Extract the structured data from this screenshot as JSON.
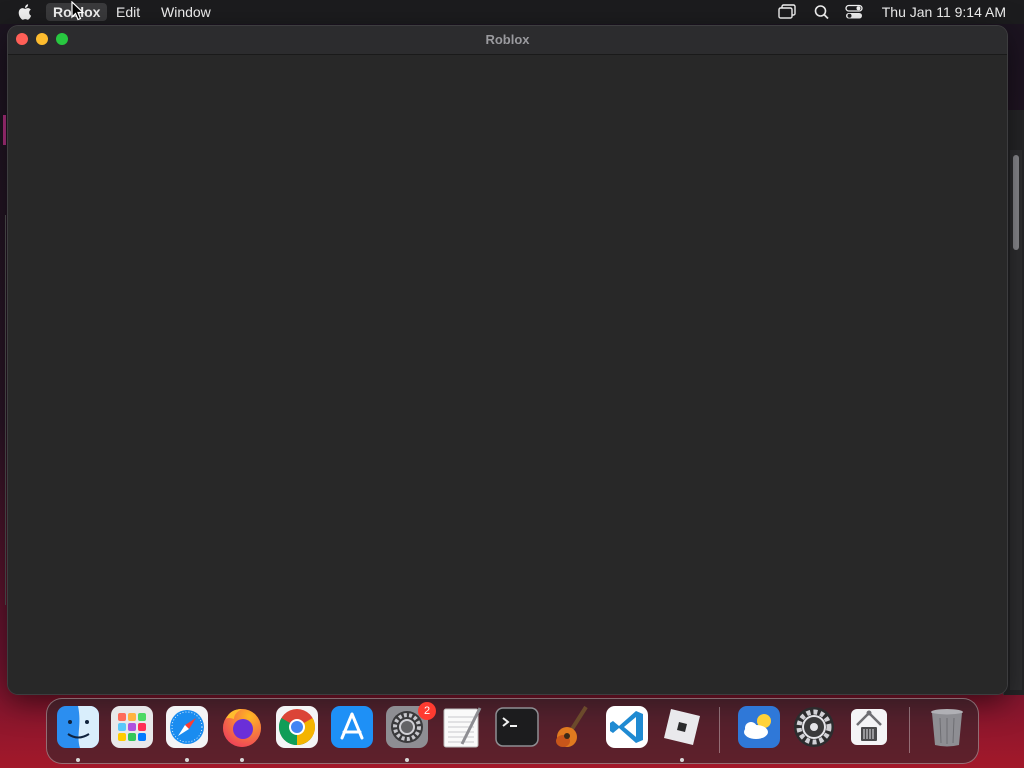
{
  "menubar": {
    "apple_icon": "apple-icon",
    "items": [
      {
        "label": "Roblox",
        "active": true
      },
      {
        "label": "Edit",
        "active": false
      },
      {
        "label": "Window",
        "active": false
      }
    ],
    "status_icons": [
      "screen-mirroring-icon",
      "spotlight-search-icon",
      "control-center-icon"
    ],
    "clock": "Thu Jan 11  9:14 AM"
  },
  "window": {
    "title": "Roblox"
  },
  "dock": {
    "apps": [
      {
        "name": "Finder",
        "icon": "finder-icon",
        "running": true
      },
      {
        "name": "Launchpad",
        "icon": "launchpad-icon",
        "running": false
      },
      {
        "name": "Safari",
        "icon": "safari-icon",
        "running": true
      },
      {
        "name": "Firefox",
        "icon": "firefox-icon",
        "running": true
      },
      {
        "name": "Google Chrome",
        "icon": "chrome-icon",
        "running": false
      },
      {
        "name": "App Store",
        "icon": "app-store-icon",
        "running": false
      },
      {
        "name": "System Preferences",
        "icon": "system-preferences-icon",
        "running": true,
        "badge": "2"
      },
      {
        "name": "TextEdit",
        "icon": "textedit-icon",
        "running": false
      },
      {
        "name": "Terminal",
        "icon": "terminal-icon",
        "running": false
      },
      {
        "name": "GarageBand",
        "icon": "garageband-icon",
        "running": false
      },
      {
        "name": "Visual Studio Code",
        "icon": "vscode-icon",
        "running": false
      },
      {
        "name": "Roblox",
        "icon": "roblox-icon",
        "running": true
      },
      {
        "name": "Weather",
        "icon": "weather-icon",
        "running": false
      },
      {
        "name": "Settings",
        "icon": "settings-gear-icon",
        "running": false
      },
      {
        "name": "System Information",
        "icon": "system-information-icon",
        "running": false
      },
      {
        "name": "Trash",
        "icon": "trash-icon",
        "running": false
      }
    ]
  }
}
